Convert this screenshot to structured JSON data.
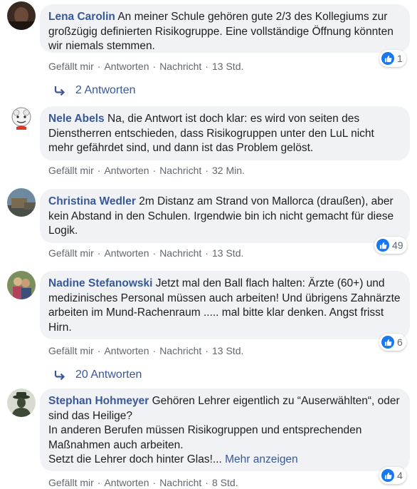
{
  "comments": [
    {
      "author": "Lena Carolin",
      "text": "An meiner Schule gehören gute 2/3 des Kollegiums zur großzügig definierten Risikogruppe. Eine vollständige Öffnung könnten wir niemals stemmen.",
      "actions": {
        "like": "Gefällt mir",
        "reply": "Antworten",
        "message": "Nachricht",
        "time": "13 Std."
      },
      "reactions": "1",
      "replies": "2 Antworten"
    },
    {
      "author": "Nele Abels",
      "text": "Na, die Antwort ist doch klar: es wird von seiten des Dienstherren entschieden, dass Risikogruppen unter den LuL nicht mehr gefährdet sind, und dann ist das Problem gelöst.",
      "actions": {
        "like": "Gefällt mir",
        "reply": "Antworten",
        "message": "Nachricht",
        "time": "32 Min."
      }
    },
    {
      "author": "Christina Wedler",
      "text": "2m Distanz am Strand von Mallorca (draußen), aber kein Abstand in den Schulen. Irgendwie bin ich nicht gemacht für diese Logik.",
      "actions": {
        "like": "Gefällt mir",
        "reply": "Antworten",
        "message": "Nachricht",
        "time": "13 Std."
      },
      "reactions": "49"
    },
    {
      "author": "Nadine Stefanowski",
      "text": "Jetzt mal den Ball flach halten: Ärzte (60+) und medizinisches Personal müssen auch arbeiten! Und übrigens Zahnärzte arbeiten im Mund-Rachenraum ..... mal bitte klar denken. Angst frisst Hirn.",
      "actions": {
        "like": "Gefällt mir",
        "reply": "Antworten",
        "message": "Nachricht",
        "time": "13 Std."
      },
      "reactions": "6",
      "replies": "20 Antworten"
    },
    {
      "author": "Stephan Hohmeyer",
      "text_lines": [
        "Gehören Lehrer eigentlich zu “Auserwählten“, oder sind das Heilige?",
        "In anderen Berufen müssen Risikogruppen und entsprechenden Maßnahmen auch arbeiten.",
        "Setzt die Lehrer doch hinter Glas!..."
      ],
      "more": "Mehr anzeigen",
      "actions": {
        "like": "Gefällt mir",
        "reply": "Antworten",
        "message": "Nachricht",
        "time": "8 Std."
      },
      "reactions": "4"
    }
  ],
  "colors": {
    "link": "#385898",
    "bubble": "#f0f2f5",
    "like": "#1877f2",
    "meta": "#606770"
  }
}
